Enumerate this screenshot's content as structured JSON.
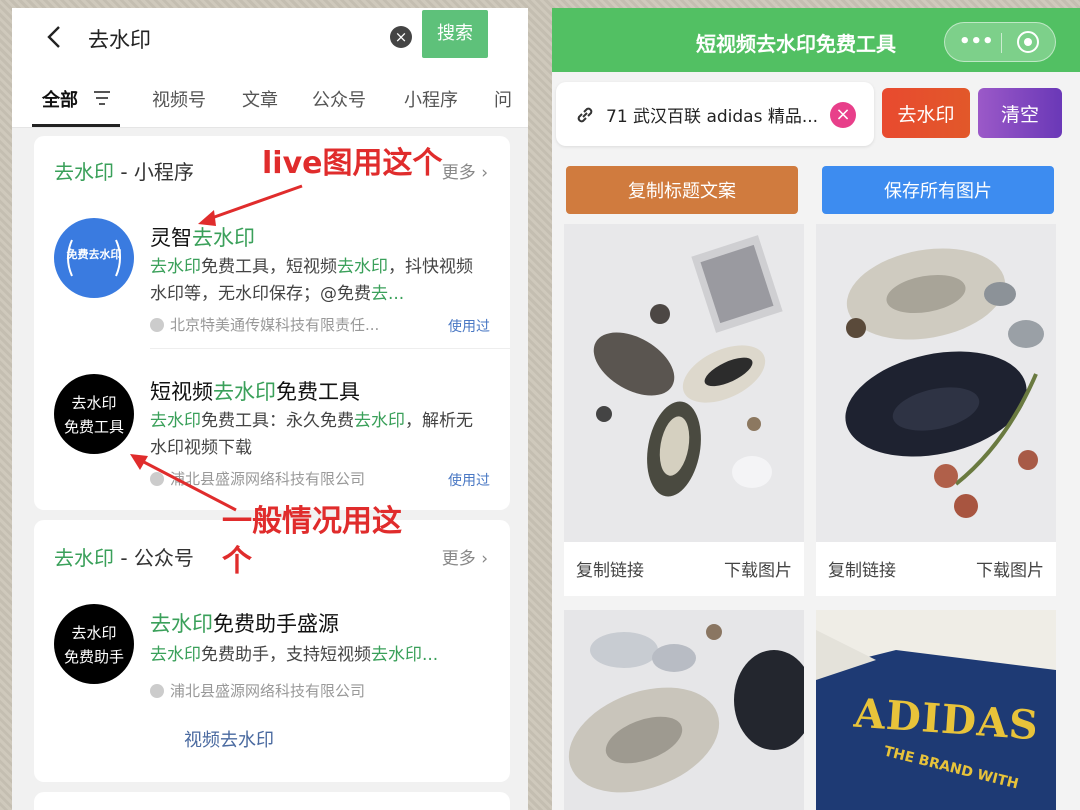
{
  "left": {
    "search": {
      "query": "去水印",
      "button_label": "搜索"
    },
    "tabs": [
      "全部",
      "视频号",
      "文章",
      "公众号",
      "小程序",
      "问"
    ],
    "section1": {
      "title_keyword": "去水印",
      "title_suffix": " - 小程序",
      "more_label": "更多",
      "items": [
        {
          "avatar_text": "免费去水印",
          "title_prefix": "灵智",
          "title_keyword": "去水印",
          "desc_parts": [
            "去水印",
            "免费工具，短视频",
            "去水印",
            "，抖快视频水印等，无水印保存；@免费",
            "去..."
          ],
          "company": "北京特美通传媒科技有限责任...",
          "used_label": "使用过"
        },
        {
          "avatar_text_line1": "去水印",
          "avatar_text_line2": "免费工具",
          "title_prefix": "短视频",
          "title_keyword": "去水印",
          "title_suffix": "免费工具",
          "desc_parts": [
            "去水印",
            "免费工具：永久免费",
            "去水印",
            "，解析无水印视频下载"
          ],
          "company": "浦北县盛源网络科技有限公司",
          "used_label": "使用过"
        }
      ]
    },
    "section2": {
      "title_keyword": "去水印",
      "title_suffix": " - 公众号",
      "more_label": "更多",
      "item": {
        "avatar_text_line1": "去水印",
        "avatar_text_line2": "免费助手",
        "title_keyword": "去水印",
        "title_suffix": "免费助手盛源",
        "desc_parts": [
          "去水印",
          "免费助手，支持短视频",
          "去水印..."
        ],
        "company": "浦北县盛源网络科技有限公司",
        "sub_link": "视频去水印"
      }
    },
    "annotations": {
      "top": "live图用这个",
      "bottom_line1": "一般情况用这",
      "bottom_line2": "个"
    }
  },
  "right": {
    "title": "短视频去水印免费工具",
    "capsule_more": "•••",
    "url_text": "71 武汉百联 adidas 精品...",
    "remove_button": "去水印",
    "clear_button": "清空",
    "copy_title_button": "复制标题文案",
    "save_all_button": "保存所有图片",
    "photo_actions": {
      "copy_link": "复制链接",
      "download": "下载图片"
    },
    "photo_text": "ADIDAS",
    "photo_subtext": "THE BRAND WITH"
  },
  "colors": {
    "accent_green": "#52c063",
    "keyword_green": "#3aa05a",
    "annotation_red": "#e02c2c"
  }
}
